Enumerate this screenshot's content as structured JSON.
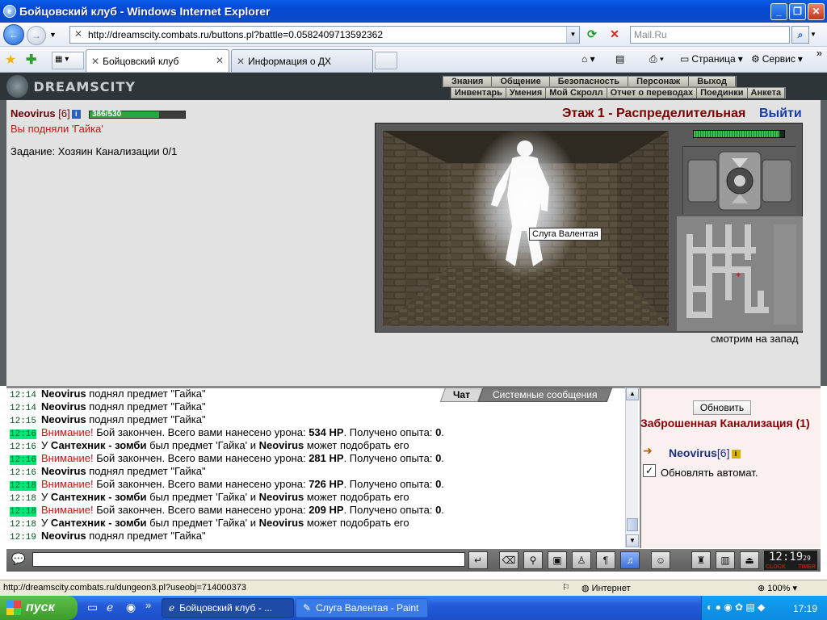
{
  "window": {
    "title": "Бойцовский клуб - Windows Internet Explorer"
  },
  "browser": {
    "address": "http://dreamscity.combats.ru/buttons.pl?battle=0.0582409713592362",
    "search_placeholder": "Mail.Ru",
    "tabs": [
      {
        "label": "Бойцовский клуб"
      },
      {
        "label": "Информация о ДХ"
      }
    ],
    "commands": {
      "page": "Страница",
      "service": "Сервис"
    }
  },
  "game": {
    "logo": "DREAMSCITY",
    "menu_top": [
      "Знания",
      "Общение",
      "Безопасность",
      "Персонаж",
      "Выход"
    ],
    "menu_bottom": [
      "Инвентарь",
      "Умения",
      "Мой Скролл",
      "Отчет о переводах",
      "Поединки",
      "Анкета"
    ],
    "player": {
      "name": "Neovirus",
      "level": "[6]",
      "hp_text": "386/530",
      "hp_fraction": 0.728
    },
    "pickup_message": "Вы подняли 'Гайка'",
    "quest": "Задание: Хозяин Канализации 0/1",
    "floor": "Этаж 1 - Распределительная",
    "exit": "Выйти",
    "tooltip": "Слуга Валентая",
    "facing": "смотрим на запад",
    "minimap_hp_fraction": 0.95
  },
  "chat": {
    "tabs": {
      "chat": "Чат",
      "system": "Системные сообщения"
    },
    "lines": [
      {
        "time": "12:14",
        "hl": false,
        "parts": [
          {
            "t": "Neovirus",
            "s": "b"
          },
          {
            "t": " поднял предмет \"Гайка\"",
            "s": ""
          }
        ]
      },
      {
        "time": "12:14",
        "hl": false,
        "parts": [
          {
            "t": "Neovirus",
            "s": "b"
          },
          {
            "t": " поднял предмет \"Гайка\"",
            "s": ""
          }
        ]
      },
      {
        "time": "12:15",
        "hl": false,
        "parts": [
          {
            "t": "Neovirus",
            "s": "b"
          },
          {
            "t": " поднял предмет \"Гайка\"",
            "s": ""
          }
        ]
      },
      {
        "time": "12:16",
        "hl": true,
        "parts": [
          {
            "t": "Внимание!",
            "s": "warn"
          },
          {
            "t": " Бой закончен. Всего вами нанесено урона: ",
            "s": ""
          },
          {
            "t": "534 HP",
            "s": "b"
          },
          {
            "t": ". Получено опыта: ",
            "s": ""
          },
          {
            "t": "0",
            "s": "b"
          },
          {
            "t": ".",
            "s": ""
          }
        ]
      },
      {
        "time": "12:16",
        "hl": false,
        "parts": [
          {
            "t": "У ",
            "s": ""
          },
          {
            "t": "Сантехник - зомби",
            "s": "b"
          },
          {
            "t": " был предмет 'Гайка' и ",
            "s": ""
          },
          {
            "t": "Neovirus",
            "s": "b"
          },
          {
            "t": " может подобрать его",
            "s": ""
          }
        ]
      },
      {
        "time": "12:16",
        "hl": true,
        "parts": [
          {
            "t": "Внимание!",
            "s": "warn"
          },
          {
            "t": " Бой закончен. Всего вами нанесено урона: ",
            "s": ""
          },
          {
            "t": "281 HP",
            "s": "b"
          },
          {
            "t": ". Получено опыта: ",
            "s": ""
          },
          {
            "t": "0",
            "s": "b"
          },
          {
            "t": ".",
            "s": ""
          }
        ]
      },
      {
        "time": "12:16",
        "hl": false,
        "parts": [
          {
            "t": "Neovirus",
            "s": "b"
          },
          {
            "t": " поднял предмет \"Гайка\"",
            "s": ""
          }
        ]
      },
      {
        "time": "12:18",
        "hl": true,
        "parts": [
          {
            "t": "Внимание!",
            "s": "warn"
          },
          {
            "t": " Бой закончен. Всего вами нанесено урона: ",
            "s": ""
          },
          {
            "t": "726 HP",
            "s": "b"
          },
          {
            "t": ". Получено опыта: ",
            "s": ""
          },
          {
            "t": "0",
            "s": "b"
          },
          {
            "t": ".",
            "s": ""
          }
        ]
      },
      {
        "time": "12:18",
        "hl": false,
        "parts": [
          {
            "t": "У ",
            "s": ""
          },
          {
            "t": "Сантехник - зомби",
            "s": "b"
          },
          {
            "t": " был предмет 'Гайка' и ",
            "s": ""
          },
          {
            "t": "Neovirus",
            "s": "b"
          },
          {
            "t": " может подобрать его",
            "s": ""
          }
        ]
      },
      {
        "time": "12:18",
        "hl": true,
        "parts": [
          {
            "t": "Внимание!",
            "s": "warn"
          },
          {
            "t": " Бой закончен. Всего вами нанесено урона: ",
            "s": ""
          },
          {
            "t": "209 HP",
            "s": "b"
          },
          {
            "t": ". Получено опыта: ",
            "s": ""
          },
          {
            "t": "0",
            "s": "b"
          },
          {
            "t": ".",
            "s": ""
          }
        ]
      },
      {
        "time": "12:18",
        "hl": false,
        "parts": [
          {
            "t": "У ",
            "s": ""
          },
          {
            "t": "Сантехник - зомби",
            "s": "b"
          },
          {
            "t": " был предмет 'Гайка' и ",
            "s": ""
          },
          {
            "t": "Neovirus",
            "s": "b"
          },
          {
            "t": " может подобрать его",
            "s": ""
          }
        ]
      },
      {
        "time": "12:19",
        "hl": false,
        "parts": [
          {
            "t": "Neovirus",
            "s": "b"
          },
          {
            "t": " поднял предмет \"Гайка\"",
            "s": ""
          }
        ]
      }
    ]
  },
  "side": {
    "refresh": "Обновить",
    "location": "Заброшенная Канализация (1)",
    "user_name": "Neovirus",
    "user_level": "[6]",
    "auto_refresh_label": "Обновлять автомат.",
    "auto_refresh_checked": true
  },
  "clock": {
    "time": "12:19",
    "seconds": "29",
    "left_label": "CLOCK",
    "right_label": "TIMER"
  },
  "status": {
    "url": "http://dreamscity.combats.ru/dungeon3.pl?useobj=714000373",
    "zone": "Интернет",
    "zoom": "100%"
  },
  "taskbar": {
    "start": "пуск",
    "tasks": [
      "Бойцовский клуб - ...",
      "Слуга Валентая - Paint"
    ],
    "time": "17:19"
  }
}
